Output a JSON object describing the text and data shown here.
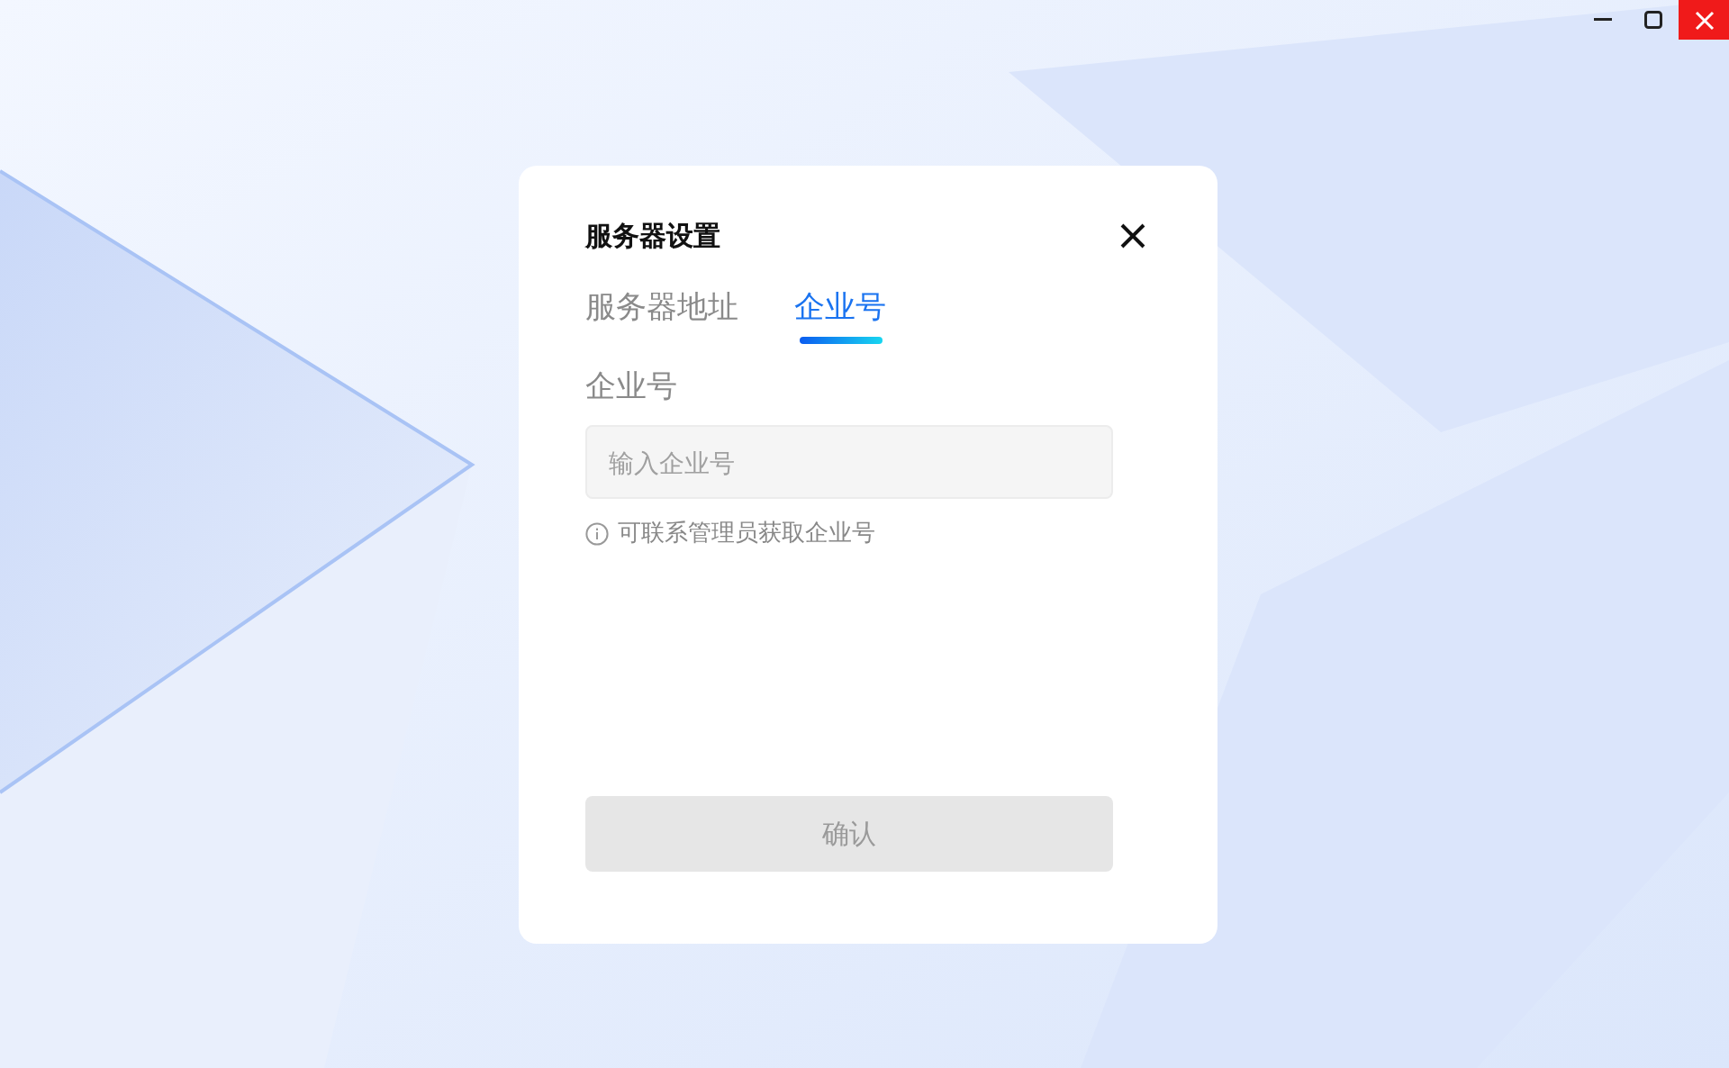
{
  "window_controls": [
    {
      "kind": "minimize"
    },
    {
      "kind": "maximize"
    },
    {
      "kind": "close"
    }
  ],
  "dialog": {
    "title": "服务器设置",
    "tabs": [
      {
        "label": "服务器地址",
        "selected": false
      },
      {
        "label": "企业号",
        "selected": true
      }
    ],
    "field_label": "企业号",
    "input": {
      "placeholder": "输入企业号"
    },
    "hint": "可联系管理员获取企业号",
    "confirm_button": {
      "label": "确认",
      "disabled": true
    }
  }
}
